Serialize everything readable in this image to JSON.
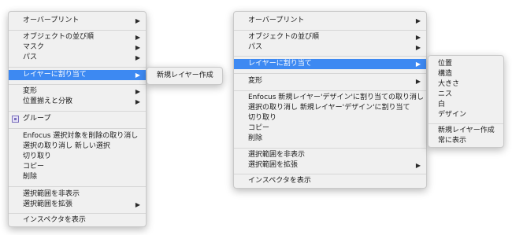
{
  "menu1": {
    "overprint": "オーバープリント",
    "arrange": "オブジェクトの並び順",
    "mask": "マスク",
    "path": "パス",
    "assign_layer": "レイヤーに割り当て",
    "transform": "変形",
    "align": "位置揃えと分散",
    "group": "グループ",
    "undo_delete": "Enfocus 選択対象を削除の取り消し",
    "undo_select": "選択の取り消し 新しい選択",
    "cut": "切り取り",
    "copy": "コピー",
    "delete": "削除",
    "hide_selection": "選択範囲を非表示",
    "expand_selection": "選択範囲を拡張",
    "show_inspector": "インスペクタを表示"
  },
  "submenu1": {
    "new_layer": "新規レイヤー作成"
  },
  "menu2": {
    "overprint": "オーバープリント",
    "arrange": "オブジェクトの並び順",
    "path": "パス",
    "assign_layer": "レイヤーに割り当て",
    "transform": "変形",
    "undo_new_layer": "Enfocus 新規レイヤー'デザイン'に割り当ての取り消し",
    "undo_select": "選択の取り消し 新規レイヤー'デザイン'に割り当て",
    "cut": "切り取り",
    "copy": "コピー",
    "delete": "削除",
    "hide_selection": "選択範囲を非表示",
    "expand_selection": "選択範囲を拡張",
    "show_inspector": "インスペクタを表示"
  },
  "submenu2": {
    "layers": [
      "位置",
      "構造",
      "大きさ",
      "ニス",
      "白",
      "デザイン"
    ],
    "new_layer": "新規レイヤー作成",
    "always_show": "常に表示"
  },
  "arrow_glyph": "▶",
  "highlight_color": "#3d89f2"
}
